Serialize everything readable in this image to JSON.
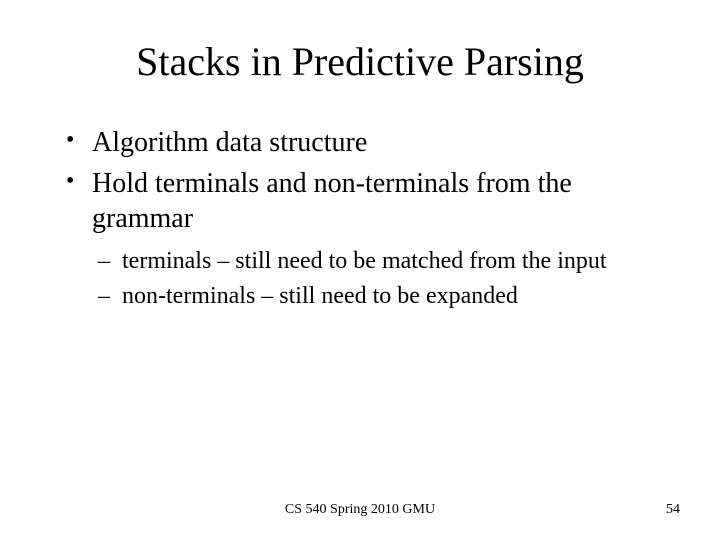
{
  "title": "Stacks in Predictive Parsing",
  "bullets": {
    "b1": "Algorithm data structure",
    "b2": "Hold terminals and non-terminals from the grammar",
    "sub1": "terminals – still need to be matched from the input",
    "sub2": "non-terminals – still need to be expanded"
  },
  "footer": {
    "center": "CS 540 Spring 2010 GMU",
    "number": "54"
  }
}
